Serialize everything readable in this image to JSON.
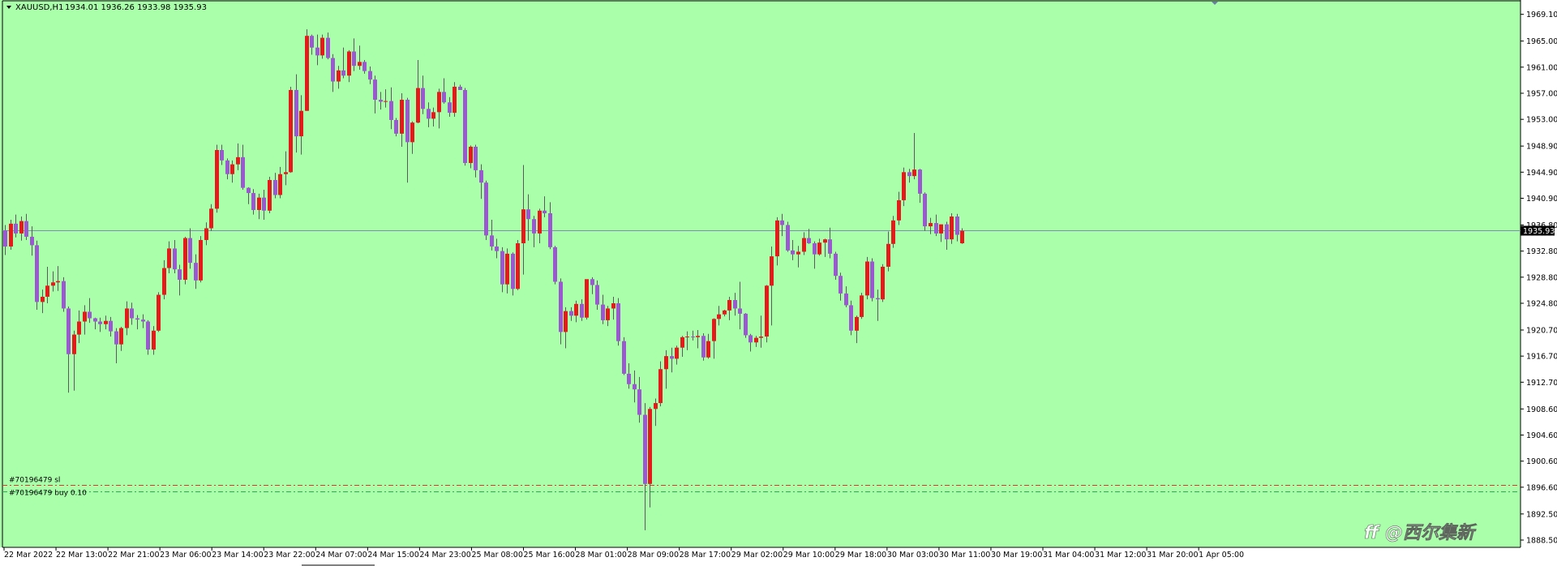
{
  "header": {
    "symbol": "XAUUSD,H1",
    "ohlc": "1934.01 1936.26 1933.98 1935.93"
  },
  "colors": {
    "background": "#aaffaa",
    "bull": "#e31b1b",
    "bear": "#9b59d0",
    "wick": "#5a5a5a",
    "price_line": "#7a8fa8",
    "sl_line": "#e33030",
    "buy_line": "#2fa84f",
    "axis": "#000000"
  },
  "orders": [
    {
      "label": "#70196479 sl",
      "price": 1897.0
    },
    {
      "label": "#70196479 buy 0.10",
      "price": 1895.9
    }
  ],
  "watermark": "ff @西尔集新",
  "chart_data": {
    "type": "candlestick",
    "symbol": "XAUUSD",
    "timeframe": "H1",
    "ylim": [
      1888.5,
      1970.3
    ],
    "grid": false,
    "y_ticks": [
      "1969.10",
      "1965.00",
      "1961.00",
      "1957.00",
      "1953.00",
      "1948.90",
      "1944.90",
      "1940.90",
      "1936.80",
      "1932.80",
      "1928.80",
      "1924.80",
      "1920.70",
      "1916.70",
      "1912.70",
      "1908.60",
      "1904.60",
      "1900.60",
      "1896.60",
      "1892.50",
      "1888.50"
    ],
    "x_ticks": [
      "22 Mar 2022",
      "22 Mar 13:00",
      "22 Mar 21:00",
      "23 Mar 06:00",
      "23 Mar 14:00",
      "23 Mar 22:00",
      "24 Mar 07:00",
      "24 Mar 15:00",
      "24 Mar 23:00",
      "25 Mar 08:00",
      "25 Mar 16:00",
      "28 Mar 01:00",
      "28 Mar 09:00",
      "28 Mar 17:00",
      "29 Mar 02:00",
      "29 Mar 10:00",
      "29 Mar 18:00",
      "30 Mar 03:00",
      "30 Mar 11:00",
      "30 Mar 19:00",
      "31 Mar 04:00",
      "31 Mar 12:00",
      "31 Mar 20:00",
      "1 Apr 05:00"
    ],
    "current_price": 1935.93,
    "candles": [
      [
        1936.0,
        1936.8,
        1932.2,
        1933.5
      ],
      [
        1933.5,
        1937.6,
        1933.0,
        1937.0
      ],
      [
        1937.0,
        1938.4,
        1934.9,
        1935.5
      ],
      [
        1935.5,
        1938.1,
        1934.4,
        1937.4
      ],
      [
        1937.4,
        1938.5,
        1934.5,
        1935.0
      ],
      [
        1935.0,
        1936.6,
        1932.1,
        1933.7
      ],
      [
        1933.7,
        1934.4,
        1923.8,
        1925.0
      ],
      [
        1925.0,
        1926.9,
        1923.3,
        1925.8
      ],
      [
        1925.8,
        1930.4,
        1924.8,
        1927.5
      ],
      [
        1927.5,
        1929.7,
        1926.6,
        1928.0
      ],
      [
        1928.0,
        1930.5,
        1926.7,
        1928.2
      ],
      [
        1928.2,
        1928.8,
        1923.5,
        1924.0
      ],
      [
        1924.0,
        1924.3,
        1911.1,
        1917.0
      ],
      [
        1917.0,
        1920.6,
        1911.4,
        1920.0
      ],
      [
        1920.0,
        1923.7,
        1918.7,
        1922.0
      ],
      [
        1922.0,
        1924.5,
        1920.0,
        1923.5
      ],
      [
        1923.5,
        1925.6,
        1921.8,
        1922.5
      ],
      [
        1922.5,
        1922.6,
        1920.8,
        1922.0
      ],
      [
        1922.0,
        1922.6,
        1920.4,
        1921.6
      ],
      [
        1921.6,
        1922.9,
        1920.8,
        1922.1
      ],
      [
        1922.1,
        1922.7,
        1919.7,
        1920.5
      ],
      [
        1920.5,
        1921.0,
        1915.6,
        1918.5
      ],
      [
        1918.5,
        1921.2,
        1917.5,
        1921.0
      ],
      [
        1921.0,
        1925.1,
        1919.9,
        1924.0
      ],
      [
        1924.0,
        1924.9,
        1921.5,
        1922.5
      ],
      [
        1922.5,
        1923.0,
        1920.8,
        1922.3
      ],
      [
        1922.3,
        1923.1,
        1921.0,
        1922.0
      ],
      [
        1922.0,
        1922.2,
        1916.9,
        1917.7
      ],
      [
        1917.7,
        1921.3,
        1916.9,
        1920.6
      ],
      [
        1920.6,
        1926.5,
        1920.4,
        1926.1
      ],
      [
        1926.1,
        1931.4,
        1925.4,
        1930.2
      ],
      [
        1930.2,
        1934.3,
        1929.4,
        1933.2
      ],
      [
        1933.2,
        1934.5,
        1929.4,
        1930.0
      ],
      [
        1930.0,
        1930.7,
        1926.0,
        1928.4
      ],
      [
        1928.4,
        1935.0,
        1927.7,
        1934.8
      ],
      [
        1934.8,
        1936.3,
        1930.1,
        1931.0
      ],
      [
        1931.0,
        1932.3,
        1927.0,
        1928.3
      ],
      [
        1928.3,
        1935.1,
        1928.0,
        1934.5
      ],
      [
        1934.5,
        1937.2,
        1933.7,
        1936.3
      ],
      [
        1936.3,
        1940.0,
        1935.9,
        1939.3
      ],
      [
        1939.3,
        1949.1,
        1938.7,
        1948.3
      ],
      [
        1948.3,
        1949.1,
        1946.0,
        1946.7
      ],
      [
        1946.7,
        1947.0,
        1943.8,
        1944.6
      ],
      [
        1944.6,
        1946.7,
        1943.3,
        1946.1
      ],
      [
        1946.1,
        1949.3,
        1945.2,
        1947.2
      ],
      [
        1947.2,
        1949.1,
        1942.2,
        1942.5
      ],
      [
        1942.5,
        1942.6,
        1940.0,
        1941.7
      ],
      [
        1941.7,
        1942.3,
        1938.4,
        1939.1
      ],
      [
        1939.1,
        1941.6,
        1937.7,
        1941.0
      ],
      [
        1941.0,
        1942.2,
        1937.6,
        1939.0
      ],
      [
        1939.0,
        1944.2,
        1938.6,
        1943.7
      ],
      [
        1943.7,
        1944.8,
        1940.9,
        1941.4
      ],
      [
        1941.4,
        1945.7,
        1940.9,
        1944.6
      ],
      [
        1944.6,
        1948.1,
        1942.9,
        1944.9
      ],
      [
        1944.9,
        1958.0,
        1944.8,
        1957.5
      ],
      [
        1957.5,
        1959.9,
        1947.9,
        1950.4
      ],
      [
        1950.4,
        1956.7,
        1947.6,
        1954.3
      ],
      [
        1954.3,
        1966.8,
        1954.3,
        1965.8
      ],
      [
        1965.8,
        1966.0,
        1962.9,
        1964.0
      ],
      [
        1964.0,
        1966.0,
        1961.3,
        1962.8
      ],
      [
        1962.8,
        1966.0,
        1962.3,
        1965.5
      ],
      [
        1965.5,
        1966.3,
        1962.2,
        1962.4
      ],
      [
        1962.4,
        1963.0,
        1957.2,
        1958.8
      ],
      [
        1958.8,
        1961.2,
        1957.7,
        1960.5
      ],
      [
        1960.5,
        1964.0,
        1959.3,
        1959.7
      ],
      [
        1959.7,
        1963.6,
        1958.7,
        1963.4
      ],
      [
        1963.4,
        1965.4,
        1960.4,
        1961.2
      ],
      [
        1961.2,
        1964.3,
        1960.6,
        1961.8
      ],
      [
        1961.8,
        1962.1,
        1960.0,
        1960.4
      ],
      [
        1960.4,
        1961.1,
        1958.4,
        1959.1
      ],
      [
        1959.1,
        1959.7,
        1953.9,
        1956.0
      ],
      [
        1956.0,
        1957.2,
        1954.5,
        1955.7
      ],
      [
        1955.7,
        1957.6,
        1954.8,
        1955.8
      ],
      [
        1955.8,
        1957.9,
        1951.5,
        1952.9
      ],
      [
        1952.9,
        1953.2,
        1950.4,
        1950.8
      ],
      [
        1950.8,
        1957.0,
        1948.8,
        1956.0
      ],
      [
        1956.0,
        1956.3,
        1943.3,
        1949.5
      ],
      [
        1949.5,
        1952.7,
        1947.7,
        1952.5
      ],
      [
        1952.5,
        1962.1,
        1952.4,
        1957.8
      ],
      [
        1957.8,
        1959.7,
        1953.8,
        1954.6
      ],
      [
        1954.6,
        1955.6,
        1951.8,
        1953.1
      ],
      [
        1953.1,
        1954.8,
        1951.9,
        1954.1
      ],
      [
        1954.1,
        1957.7,
        1951.6,
        1957.2
      ],
      [
        1957.2,
        1959.3,
        1955.4,
        1955.6
      ],
      [
        1955.6,
        1956.4,
        1953.4,
        1954.0
      ],
      [
        1954.0,
        1958.7,
        1953.4,
        1958.0
      ],
      [
        1958.0,
        1958.3,
        1957.5,
        1957.5
      ],
      [
        1957.5,
        1957.8,
        1945.9,
        1946.3
      ],
      [
        1946.3,
        1949.0,
        1945.5,
        1948.8
      ],
      [
        1948.8,
        1949.1,
        1944.1,
        1945.2
      ],
      [
        1945.2,
        1946.1,
        1940.8,
        1943.3
      ],
      [
        1943.3,
        1943.6,
        1934.5,
        1935.2
      ],
      [
        1935.2,
        1937.6,
        1932.9,
        1933.5
      ],
      [
        1933.5,
        1934.7,
        1931.7,
        1932.8
      ],
      [
        1932.8,
        1933.4,
        1926.5,
        1927.7
      ],
      [
        1927.7,
        1933.2,
        1926.3,
        1932.4
      ],
      [
        1932.4,
        1932.6,
        1926.0,
        1927.0
      ],
      [
        1927.0,
        1934.5,
        1926.8,
        1934.0
      ],
      [
        1934.0,
        1946.0,
        1929.2,
        1939.2
      ],
      [
        1939.2,
        1941.5,
        1934.4,
        1937.7
      ],
      [
        1937.7,
        1938.2,
        1933.4,
        1935.5
      ],
      [
        1935.5,
        1939.3,
        1934.0,
        1939.0
      ],
      [
        1939.0,
        1941.2,
        1938.0,
        1938.6
      ],
      [
        1938.6,
        1940.3,
        1933.1,
        1933.4
      ],
      [
        1933.4,
        1933.6,
        1927.7,
        1928.1
      ],
      [
        1928.1,
        1928.6,
        1918.5,
        1920.4
      ],
      [
        1920.4,
        1924.2,
        1917.9,
        1923.6
      ],
      [
        1923.6,
        1924.2,
        1922.1,
        1922.9
      ],
      [
        1922.9,
        1925.2,
        1921.9,
        1924.7
      ],
      [
        1924.7,
        1925.4,
        1922.1,
        1922.6
      ],
      [
        1922.6,
        1926.4,
        1922.3,
        1928.5
      ],
      [
        1928.5,
        1928.8,
        1926.2,
        1927.6
      ],
      [
        1927.6,
        1928.3,
        1923.8,
        1924.6
      ],
      [
        1924.6,
        1926.1,
        1921.6,
        1922.2
      ],
      [
        1922.2,
        1924.4,
        1921.3,
        1924.0
      ],
      [
        1924.0,
        1925.8,
        1922.3,
        1924.8
      ],
      [
        1924.8,
        1925.6,
        1918.3,
        1919.0
      ],
      [
        1919.0,
        1919.6,
        1913.8,
        1914.0
      ],
      [
        1914.0,
        1915.6,
        1911.7,
        1912.4
      ],
      [
        1912.4,
        1914.5,
        1909.6,
        1911.6
      ],
      [
        1911.6,
        1913.5,
        1906.5,
        1907.7
      ],
      [
        1907.7,
        1909.5,
        1890.0,
        1897.1
      ],
      [
        1897.1,
        1908.9,
        1893.5,
        1908.6
      ],
      [
        1908.6,
        1910.2,
        1906.0,
        1909.5
      ],
      [
        1909.5,
        1915.9,
        1909.0,
        1914.7
      ],
      [
        1914.7,
        1917.6,
        1911.7,
        1916.7
      ],
      [
        1916.7,
        1918.0,
        1914.2,
        1916.3
      ],
      [
        1916.3,
        1918.3,
        1915.4,
        1918.0
      ],
      [
        1918.0,
        1919.8,
        1916.6,
        1919.6
      ],
      [
        1919.6,
        1920.5,
        1917.6,
        1919.7
      ],
      [
        1919.7,
        1920.6,
        1919.1,
        1919.6
      ],
      [
        1919.6,
        1920.7,
        1917.9,
        1919.8
      ],
      [
        1919.8,
        1920.2,
        1916.0,
        1916.5
      ],
      [
        1916.5,
        1920.1,
        1916.3,
        1919.0
      ],
      [
        1919.0,
        1922.5,
        1916.3,
        1922.4
      ],
      [
        1922.4,
        1924.4,
        1921.4,
        1923.1
      ],
      [
        1923.1,
        1923.8,
        1922.8,
        1923.7
      ],
      [
        1923.7,
        1925.8,
        1922.2,
        1925.3
      ],
      [
        1925.3,
        1926.4,
        1922.9,
        1924.0
      ],
      [
        1924.0,
        1928.1,
        1920.8,
        1923.2
      ],
      [
        1923.2,
        1923.3,
        1919.5,
        1919.9
      ],
      [
        1919.9,
        1920.1,
        1917.4,
        1918.8
      ],
      [
        1918.8,
        1919.8,
        1918.1,
        1919.5
      ],
      [
        1919.5,
        1922.9,
        1918.0,
        1919.7
      ],
      [
        1919.7,
        1927.6,
        1918.8,
        1927.5
      ],
      [
        1927.5,
        1933.5,
        1921.4,
        1932.0
      ],
      [
        1932.0,
        1938.0,
        1930.6,
        1937.5
      ],
      [
        1937.5,
        1938.5,
        1935.1,
        1936.8
      ],
      [
        1936.8,
        1937.3,
        1932.7,
        1932.9
      ],
      [
        1932.9,
        1934.5,
        1931.4,
        1932.3
      ],
      [
        1932.3,
        1933.6,
        1930.3,
        1932.7
      ],
      [
        1932.7,
        1935.7,
        1932.2,
        1934.8
      ],
      [
        1934.8,
        1936.2,
        1933.9,
        1934.0
      ],
      [
        1934.0,
        1934.3,
        1930.1,
        1932.3
      ],
      [
        1932.3,
        1934.7,
        1932.1,
        1934.1
      ],
      [
        1934.1,
        1934.7,
        1931.9,
        1934.6
      ],
      [
        1934.6,
        1936.4,
        1931.7,
        1932.4
      ],
      [
        1932.4,
        1932.7,
        1928.4,
        1929.0
      ],
      [
        1929.0,
        1929.5,
        1925.2,
        1926.3
      ],
      [
        1926.3,
        1927.4,
        1924.2,
        1924.5
      ],
      [
        1924.5,
        1925.2,
        1919.9,
        1920.6
      ],
      [
        1920.6,
        1922.9,
        1918.7,
        1922.7
      ],
      [
        1922.7,
        1926.4,
        1922.4,
        1926.0
      ],
      [
        1926.0,
        1931.9,
        1925.4,
        1931.2
      ],
      [
        1931.2,
        1931.7,
        1925.1,
        1925.6
      ],
      [
        1925.6,
        1926.9,
        1922.1,
        1925.4
      ],
      [
        1925.4,
        1930.8,
        1925.0,
        1930.4
      ],
      [
        1930.4,
        1935.8,
        1929.7,
        1933.9
      ],
      [
        1933.9,
        1938.2,
        1933.3,
        1937.5
      ],
      [
        1937.5,
        1941.9,
        1936.8,
        1940.6
      ],
      [
        1940.6,
        1945.6,
        1939.7,
        1944.9
      ],
      [
        1944.9,
        1945.4,
        1943.3,
        1944.3
      ],
      [
        1944.3,
        1950.9,
        1943.8,
        1945.3
      ],
      [
        1945.3,
        1945.4,
        1940.2,
        1941.6
      ],
      [
        1941.6,
        1941.8,
        1935.9,
        1936.6
      ],
      [
        1936.6,
        1937.9,
        1935.4,
        1937.1
      ],
      [
        1937.1,
        1938.4,
        1935.1,
        1935.5
      ],
      [
        1935.5,
        1936.7,
        1934.2,
        1936.9
      ],
      [
        1936.9,
        1937.3,
        1933.0,
        1934.6
      ],
      [
        1934.6,
        1938.6,
        1933.9,
        1938.1
      ],
      [
        1938.1,
        1938.5,
        1934.3,
        1935.3
      ],
      [
        1934.0,
        1936.3,
        1933.9,
        1935.9
      ]
    ]
  }
}
